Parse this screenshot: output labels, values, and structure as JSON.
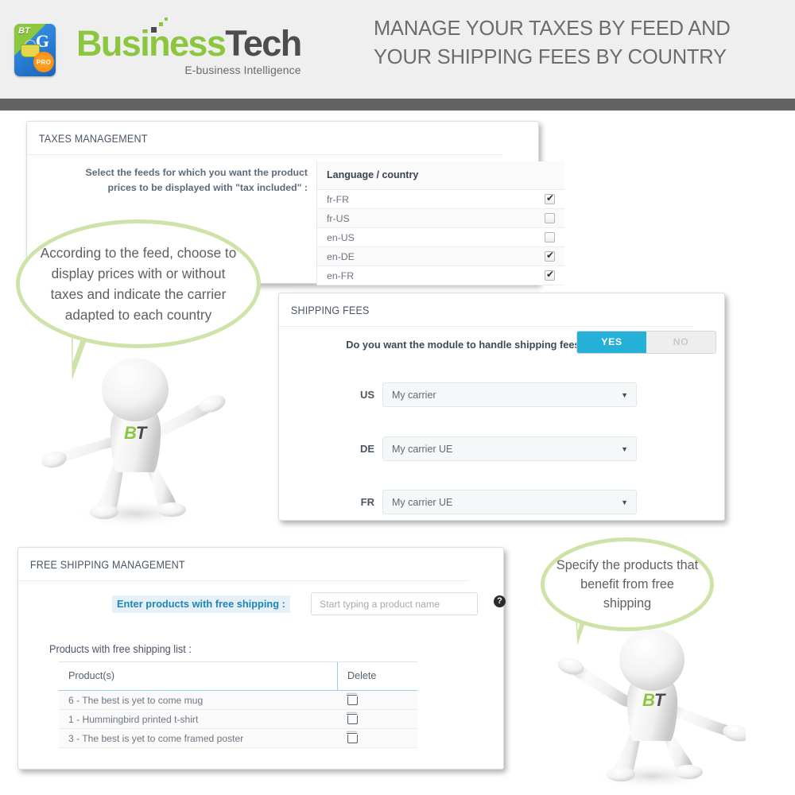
{
  "header": {
    "logo": {
      "icon_badge": "BT",
      "icon_letter": "G",
      "icon_pro": "PRO",
      "word_first": "Business",
      "word_second": "Tech",
      "tagline": "E-business Intelligence"
    },
    "title_line1": "MANAGE YOUR TAXES BY FEED AND",
    "title_line2": "YOUR SHIPPING FEES BY COUNTRY",
    "band_color": "#636363"
  },
  "taxes_panel": {
    "title": "TAXES MANAGEMENT",
    "prompt_line1": "Select the feeds for which you want the product",
    "prompt_line2": "prices to be displayed with \"tax included\" :",
    "table": {
      "column_header": "Language / country",
      "rows": [
        {
          "label": "fr-FR",
          "checked": true
        },
        {
          "label": "fr-US",
          "checked": false
        },
        {
          "label": "en-US",
          "checked": false
        },
        {
          "label": "en-DE",
          "checked": true
        },
        {
          "label": "en-FR",
          "checked": true
        }
      ]
    }
  },
  "shipping_panel": {
    "title": "SHIPPING FEES",
    "question": "Do you want the module to handle shipping  fees ?",
    "toggle": {
      "yes_label": "YES",
      "no_label": "NO",
      "selected": "YES",
      "active_color": "#25b0d7"
    },
    "carriers": [
      {
        "country": "US",
        "value": "My carrier"
      },
      {
        "country": "DE",
        "value": "My carrier  UE"
      },
      {
        "country": "FR",
        "value": "My carrier  UE"
      }
    ]
  },
  "free_shipping_panel": {
    "title": "FREE SHIPPING MANAGEMENT",
    "enter_label": "Enter products with free shipping :",
    "input_placeholder": "Start typing a product name",
    "help_icon": "?",
    "list_label": "Products with free shipping list :",
    "table": {
      "columns": [
        "Product(s)",
        "Delete"
      ],
      "rows": [
        {
          "product": "6 - The best is yet to come mug",
          "delete_icon": "trash-icon"
        },
        {
          "product": "1 - Hummingbird printed t-shirt",
          "delete_icon": "trash-icon"
        },
        {
          "product": "3 - The best is yet to come framed poster",
          "delete_icon": "trash-icon"
        }
      ]
    }
  },
  "callouts": {
    "bubble1": "According to the feed, choose to display prices with or without taxes and indicate the carrier adapted to each country",
    "bubble2": "Specify the products that benefit from free shipping",
    "border_color": "#cde3a8"
  },
  "mascot": {
    "initials_b": "B",
    "initials_t": "T"
  }
}
